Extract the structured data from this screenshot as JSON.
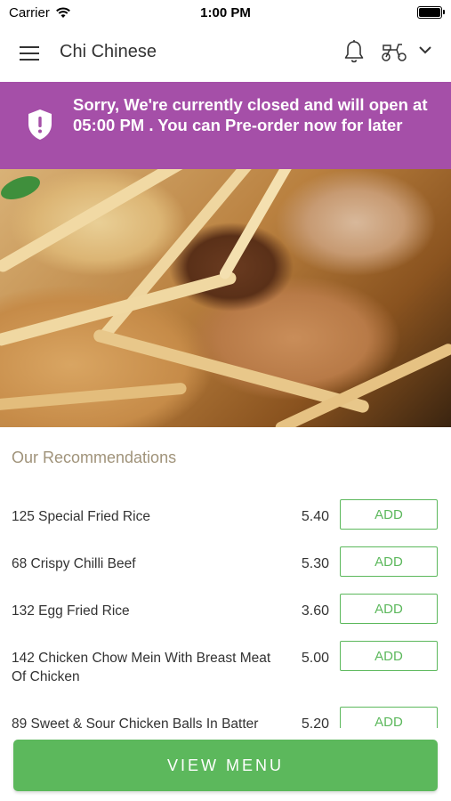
{
  "status_bar": {
    "carrier": "Carrier",
    "time": "1:00 PM"
  },
  "header": {
    "title": "Chi Chinese",
    "icons": [
      "hamburger-menu-icon",
      "bell-icon",
      "scooter-icon",
      "chevron-down-icon"
    ]
  },
  "banner": {
    "message": "Sorry, We're currently closed and will open at 05:00 PM . You can Pre-order now for later",
    "color": "#a54fa8",
    "icon": "shield-alert-icon"
  },
  "recommendations": {
    "title": "Our Recommendations",
    "items": [
      {
        "name": "125 Special Fried Rice",
        "price": "5.40",
        "button": "ADD"
      },
      {
        "name": "68 Crispy Chilli Beef",
        "price": "5.30",
        "button": "ADD"
      },
      {
        "name": "132 Egg Fried Rice",
        "price": "3.60",
        "button": "ADD"
      },
      {
        "name": "142 Chicken Chow Mein With Breast Meat Of Chicken",
        "price": "5.00",
        "button": "ADD"
      },
      {
        "name": "89 Sweet & Sour Chicken Balls In Batter",
        "price": "5.20",
        "button": "ADD"
      }
    ]
  },
  "footer": {
    "view_menu_label": "VIEW MENU"
  },
  "colors": {
    "accent_green": "#5cb85c",
    "section_title": "#a0937a"
  }
}
